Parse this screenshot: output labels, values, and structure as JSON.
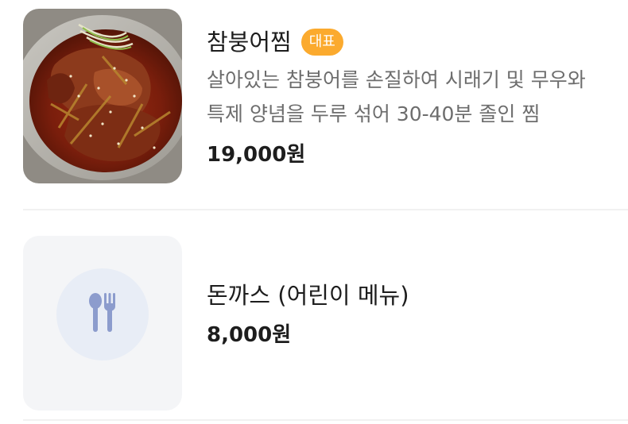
{
  "menu": {
    "items": [
      {
        "name": "참붕어찜",
        "badge": "대표",
        "description_lines": [
          "살아있는 참붕어를 손질하여 시래기 및 무우와",
          "특제 양념을 두루 섞어 30-40분 졸인 찜"
        ],
        "price": "19,000원",
        "image_icon": "braised-fish-photo"
      },
      {
        "name": "돈까스 (어린이 메뉴)",
        "price": "8,000원",
        "image_icon": "spoon-fork-icon"
      }
    ]
  },
  "colors": {
    "badge": "#fbaa2e",
    "placeholder_bg": "#f4f5f7",
    "placeholder_circle": "#e8edf6",
    "utensil": "#8c9ccd"
  }
}
